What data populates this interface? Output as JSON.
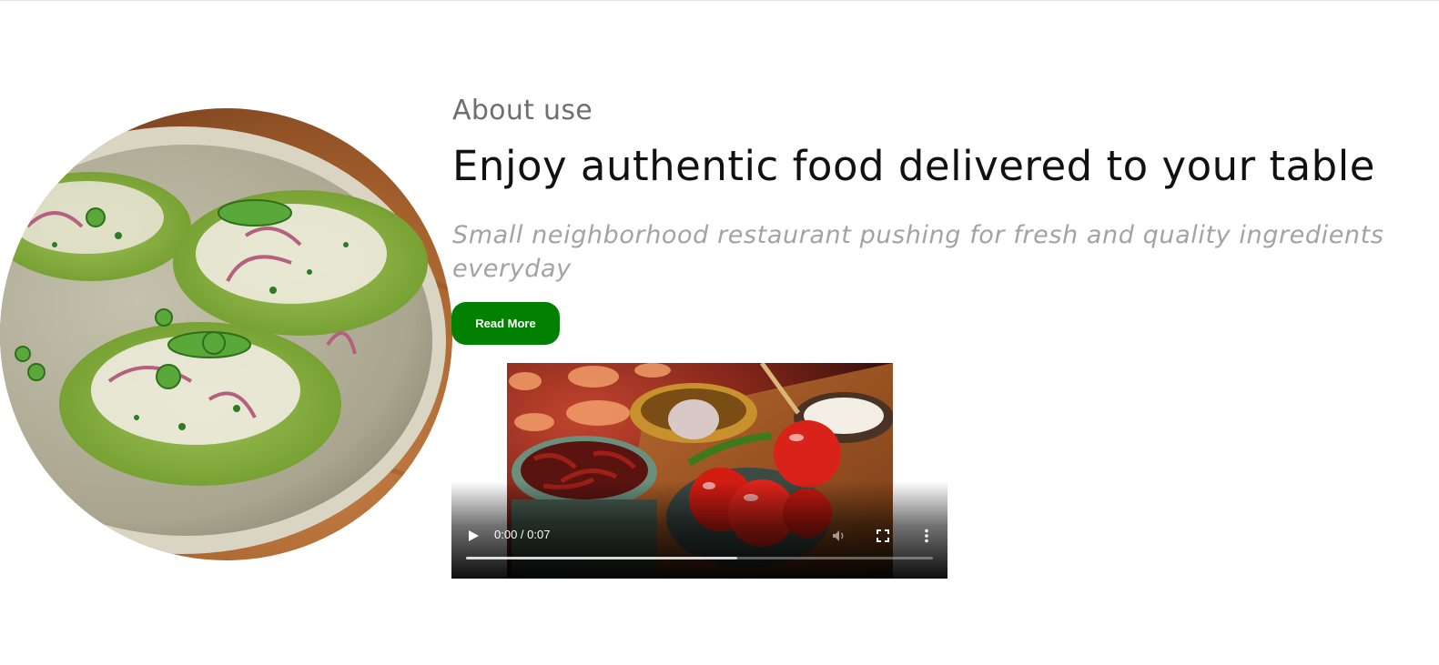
{
  "about": {
    "eyebrow": "About use",
    "headline": "Enjoy authentic food delivered to your table",
    "tagline": "Small neighborhood restaurant pushing for fresh and quality ingredients everyday",
    "read_more_label": "Read More"
  },
  "video": {
    "time": "0:00 / 0:07",
    "play_icon": "play-icon",
    "mute_icon": "volume-icon",
    "fullscreen_icon": "fullscreen-icon",
    "menu_icon": "more-vert-icon",
    "buffered_fraction": 0.58
  },
  "colors": {
    "accent": "#028002",
    "eyebrow": "#6f6f6f",
    "headline": "#111111",
    "tagline": "#a3a3a3"
  }
}
